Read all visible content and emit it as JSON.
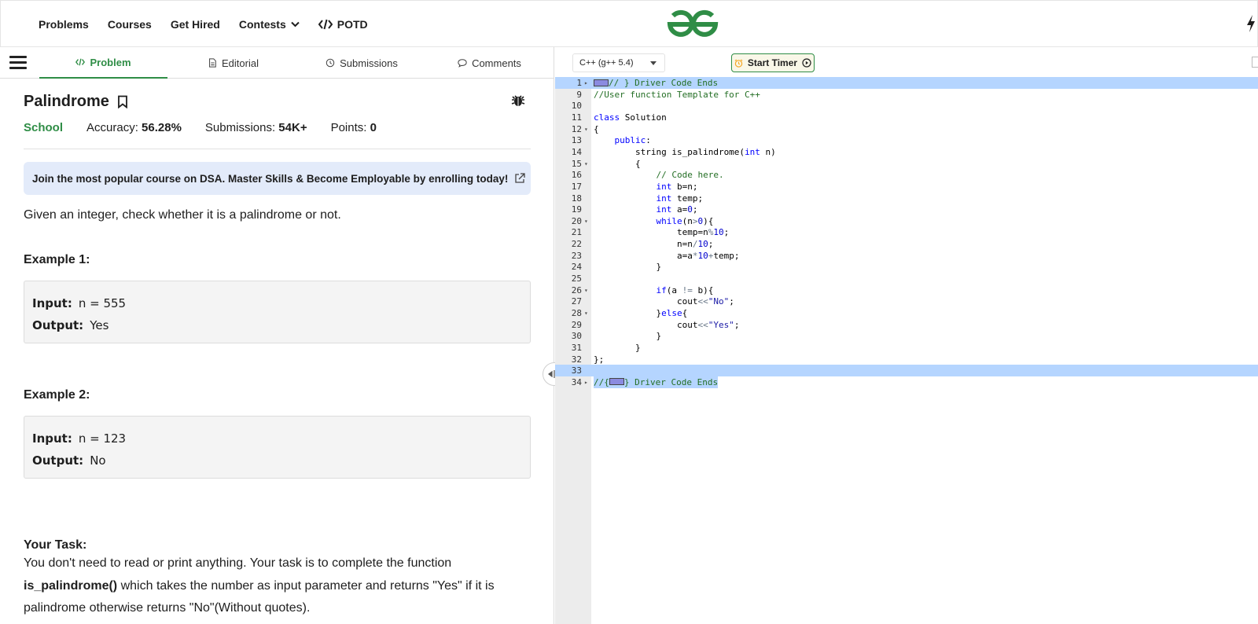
{
  "topnav": {
    "items": [
      "Problems",
      "Courses",
      "Get Hired",
      "Contests",
      "POTD"
    ]
  },
  "tabs": [
    "Problem",
    "Editorial",
    "Submissions",
    "Comments"
  ],
  "problem": {
    "title": "Palindrome",
    "difficulty": "School",
    "accuracy_label": "Accuracy:",
    "accuracy": "56.28%",
    "submissions_label": "Submissions:",
    "submissions": "54K+",
    "points_label": "Points:",
    "points": "0",
    "banner": "Join the most popular course on DSA. Master Skills & Become Employable by enrolling today!",
    "description": "Given an integer, check whether it is a palindrome or not.",
    "example1_title": "Example 1:",
    "example1_input": "n = 555",
    "example1_output": "Yes",
    "example2_title": "Example 2:",
    "example2_input": "n = 123",
    "example2_output": "No",
    "input_label": "Input:",
    "output_label": "Output:",
    "task_title": "Your Task:",
    "task_text_1": "You don't need to read or print anything. Your task is to complete the function ",
    "task_function": "is_palindrome()",
    "task_text_2": " which takes the number as input parameter and returns \"Yes\" if it is palindrome otherwise returns \"No\"(Without quotes)."
  },
  "editor": {
    "language": "C++ (g++ 5.4)",
    "timer_label": "Start Timer",
    "lines": [
      {
        "n": "1",
        "fold": "▸",
        "hl": true,
        "widget": true,
        "parts": [
          [
            "cm",
            "// } Driver Code Ends"
          ]
        ]
      },
      {
        "n": "9",
        "parts": [
          [
            "cm",
            "//User function Template for C++"
          ]
        ]
      },
      {
        "n": "10",
        "parts": []
      },
      {
        "n": "11",
        "parts": [
          [
            "kw",
            "class"
          ],
          [
            "",
            " Solution"
          ]
        ]
      },
      {
        "n": "12",
        "fold": "▾",
        "parts": [
          [
            "",
            "{"
          ]
        ]
      },
      {
        "n": "13",
        "parts": [
          [
            "",
            "    "
          ],
          [
            "kw",
            "public"
          ],
          [
            "",
            ":"
          ]
        ]
      },
      {
        "n": "14",
        "parts": [
          [
            "",
            "        string is_palindrome("
          ],
          [
            "kw",
            "int"
          ],
          [
            "",
            " n)"
          ]
        ]
      },
      {
        "n": "15",
        "fold": "▾",
        "parts": [
          [
            "",
            "        {"
          ]
        ]
      },
      {
        "n": "16",
        "parts": [
          [
            "",
            "            "
          ],
          [
            "cm",
            "// Code here."
          ]
        ]
      },
      {
        "n": "17",
        "parts": [
          [
            "",
            "            "
          ],
          [
            "kw",
            "int"
          ],
          [
            "",
            " b=n;"
          ]
        ]
      },
      {
        "n": "18",
        "parts": [
          [
            "",
            "            "
          ],
          [
            "kw",
            "int"
          ],
          [
            "",
            " temp;"
          ]
        ]
      },
      {
        "n": "19",
        "parts": [
          [
            "",
            "            "
          ],
          [
            "kw",
            "int"
          ],
          [
            "",
            " a="
          ],
          [
            "num",
            "0"
          ],
          [
            "",
            ";"
          ]
        ]
      },
      {
        "n": "20",
        "fold": "▾",
        "parts": [
          [
            "",
            "            "
          ],
          [
            "kw",
            "while"
          ],
          [
            "",
            "(n"
          ],
          [
            "op",
            ">"
          ],
          [
            "num",
            "0"
          ],
          [
            "",
            "){"
          ]
        ]
      },
      {
        "n": "21",
        "parts": [
          [
            "",
            "                temp=n"
          ],
          [
            "op",
            "%"
          ],
          [
            "num",
            "10"
          ],
          [
            "",
            ";"
          ]
        ]
      },
      {
        "n": "22",
        "parts": [
          [
            "",
            "                n=n"
          ],
          [
            "op",
            "/"
          ],
          [
            "num",
            "10"
          ],
          [
            "",
            ";"
          ]
        ]
      },
      {
        "n": "23",
        "parts": [
          [
            "",
            "                a=a"
          ],
          [
            "op",
            "*"
          ],
          [
            "num",
            "10"
          ],
          [
            "op",
            "+"
          ],
          [
            "",
            "temp;"
          ]
        ]
      },
      {
        "n": "24",
        "parts": [
          [
            "",
            "            }"
          ]
        ]
      },
      {
        "n": "25",
        "parts": []
      },
      {
        "n": "26",
        "fold": "▾",
        "parts": [
          [
            "",
            "            "
          ],
          [
            "kw",
            "if"
          ],
          [
            "",
            "(a "
          ],
          [
            "op",
            "!="
          ],
          [
            "",
            " b){"
          ]
        ]
      },
      {
        "n": "27",
        "parts": [
          [
            "",
            "                cout"
          ],
          [
            "op",
            "<<"
          ],
          [
            "str",
            "\"No\""
          ],
          [
            "",
            ";"
          ]
        ]
      },
      {
        "n": "28",
        "fold": "▾",
        "parts": [
          [
            "",
            "            }"
          ],
          [
            "kw",
            "else"
          ],
          [
            "",
            "{"
          ]
        ]
      },
      {
        "n": "29",
        "parts": [
          [
            "",
            "                cout"
          ],
          [
            "op",
            "<<"
          ],
          [
            "str",
            "\"Yes\""
          ],
          [
            "",
            ";"
          ]
        ]
      },
      {
        "n": "30",
        "parts": [
          [
            "",
            "            }"
          ]
        ]
      },
      {
        "n": "31",
        "parts": [
          [
            "",
            "        }"
          ]
        ]
      },
      {
        "n": "32",
        "parts": [
          [
            "",
            "};"
          ]
        ]
      },
      {
        "n": "33",
        "hl": true,
        "parts": []
      },
      {
        "n": "34",
        "fold": "▸",
        "hl_text": true,
        "widget_mid": true,
        "parts": [
          [
            "cm",
            "//{"
          ],
          [
            "widget",
            ""
          ],
          [
            "cm",
            "} Driver Code Ends"
          ]
        ]
      }
    ]
  },
  "colors": {
    "brand_green": "#2f8d46",
    "banner_bg": "#e3ebfa",
    "selection": "#b5d5ff"
  }
}
